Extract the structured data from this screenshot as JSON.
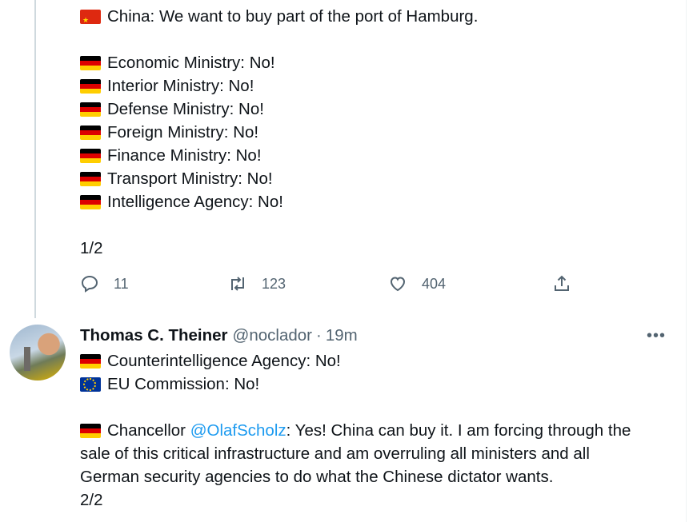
{
  "tweet1": {
    "lines": [
      {
        "flag": "cn",
        "text": "China: We want to buy part of the port of Hamburg."
      },
      {
        "flag": "de",
        "text": "Economic Ministry: No!"
      },
      {
        "flag": "de",
        "text": "Interior Ministry: No!"
      },
      {
        "flag": "de",
        "text": "Defense Ministry: No!"
      },
      {
        "flag": "de",
        "text": "Foreign Ministry: No!"
      },
      {
        "flag": "de",
        "text": "Finance Ministry: No!"
      },
      {
        "flag": "de",
        "text": "Transport Ministry: No!"
      },
      {
        "flag": "de",
        "text": "Intelligence Agency: No!"
      }
    ],
    "counter": "1/2",
    "actions": {
      "replies": "11",
      "retweets": "123",
      "likes": "404"
    }
  },
  "tweet2": {
    "author_name": "Thomas C. Theiner",
    "handle": "@noclador",
    "dot": "·",
    "time": "19m",
    "more_label": "•••",
    "lines": [
      {
        "flag": "de",
        "text": "Counterintelligence Agency: No!"
      },
      {
        "flag": "eu",
        "text": "EU Commission: No!"
      }
    ],
    "chancellor_prefix": "Chancellor",
    "mention": "@OlafScholz",
    "chancellor_line1_rest": " : Yes! China can buy it. I am forcing through the",
    "chancellor_line2": "sale of this critical infrastructure and am overruling all ministers and all",
    "chancellor_line3": "German security agencies to do what the Chinese dictator wants.",
    "counter": "2/2"
  },
  "icons": [
    "reply-icon",
    "retweet-icon",
    "like-icon",
    "share-icon",
    "more-icon"
  ],
  "colors": {
    "accent": "#1d9bf0",
    "muted": "#536471",
    "text": "#0f1419",
    "thread_line": "#cfd9de"
  }
}
